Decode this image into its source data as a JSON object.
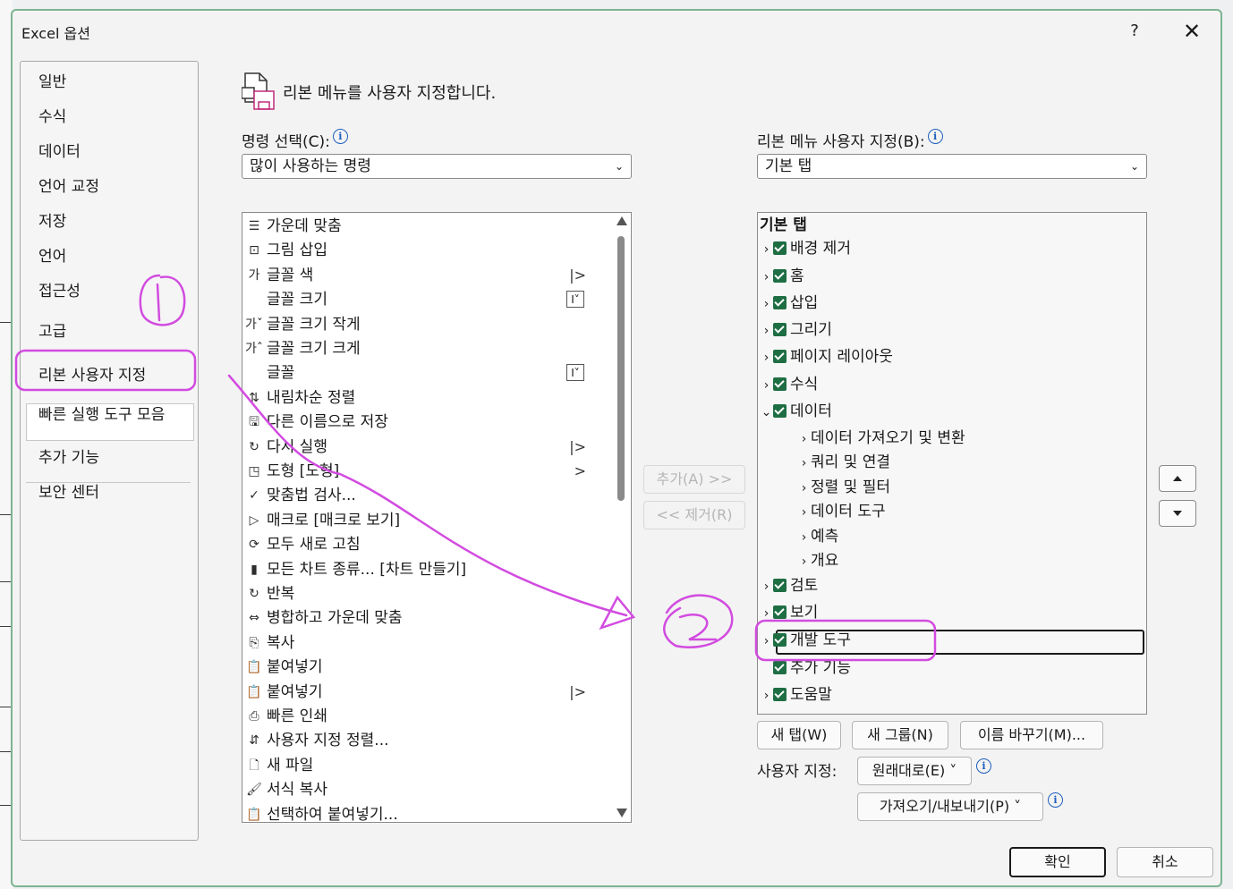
{
  "dialog": {
    "title": "Excel 옵션",
    "help": "?",
    "close": "✕"
  },
  "nav": {
    "items": [
      "일반",
      "수식",
      "데이터",
      "언어 교정",
      "저장",
      "언어",
      "접근성",
      "고급",
      "리본 사용자 지정",
      "빠른 실행 도구 모음",
      "추가 기능",
      "보안 센터"
    ],
    "selected": "리본 사용자 지정"
  },
  "header": {
    "text": "리본 메뉴를 사용자 지정합니다."
  },
  "commands": {
    "label": "명령 선택(C):",
    "combo_value": "많이 사용하는 명령",
    "items": [
      {
        "icon": "center-align-icon",
        "glyph": "☰",
        "label": "가운데 맞춤",
        "sub": ""
      },
      {
        "icon": "insert-picture-icon",
        "glyph": "⊡",
        "label": "그림 삽입",
        "sub": ""
      },
      {
        "icon": "font-color-icon",
        "glyph": "가",
        "label": "글꼴 색",
        "sub": "|>"
      },
      {
        "icon": "",
        "glyph": "",
        "label": "글꼴 크기",
        "sub": "box"
      },
      {
        "icon": "decrease-font-icon",
        "glyph": "가ˇ",
        "label": "글꼴 크기 작게",
        "sub": ""
      },
      {
        "icon": "increase-font-icon",
        "glyph": "가ˆ",
        "label": "글꼴 크기 크게",
        "sub": ""
      },
      {
        "icon": "",
        "glyph": "",
        "label": "글꼴",
        "sub": "box"
      },
      {
        "icon": "sort-descending-icon",
        "glyph": "⇅",
        "label": "내림차순 정렬",
        "sub": ""
      },
      {
        "icon": "save-as-icon",
        "glyph": "🖫",
        "label": "다른 이름으로 저장",
        "sub": ""
      },
      {
        "icon": "redo-icon",
        "glyph": "↻",
        "label": "다시 실행",
        "sub": "|>"
      },
      {
        "icon": "shapes-icon",
        "glyph": "◳",
        "label": "도형 [도형]",
        "sub": ">"
      },
      {
        "icon": "spelling-icon",
        "glyph": "✓",
        "label": "맞춤법 검사...",
        "sub": ""
      },
      {
        "icon": "macro-icon",
        "glyph": "▷",
        "label": "매크로 [매크로 보기]",
        "sub": ""
      },
      {
        "icon": "refresh-all-icon",
        "glyph": "⟳",
        "label": "모두 새로 고침",
        "sub": ""
      },
      {
        "icon": "chart-icon",
        "glyph": "▮",
        "label": "모든 차트 종류... [차트 만들기]",
        "sub": ""
      },
      {
        "icon": "repeat-icon",
        "glyph": "↻",
        "label": "반복",
        "sub": ""
      },
      {
        "icon": "merge-center-icon",
        "glyph": "⇔",
        "label": "병합하고 가운데 맞춤",
        "sub": ""
      },
      {
        "icon": "copy-icon",
        "glyph": "⎘",
        "label": "복사",
        "sub": ""
      },
      {
        "icon": "paste-icon",
        "glyph": "📋",
        "label": "붙여넣기",
        "sub": ""
      },
      {
        "icon": "paste-icon",
        "glyph": "📋",
        "label": "붙여넣기",
        "sub": "|>"
      },
      {
        "icon": "quick-print-icon",
        "glyph": "⎙",
        "label": "빠른 인쇄",
        "sub": ""
      },
      {
        "icon": "custom-sort-icon",
        "glyph": "⇵",
        "label": "사용자 지정 정렬...",
        "sub": ""
      },
      {
        "icon": "new-file-icon",
        "glyph": "🗋",
        "label": "새 파일",
        "sub": ""
      },
      {
        "icon": "format-painter-icon",
        "glyph": "🖌",
        "label": "서식 복사",
        "sub": ""
      },
      {
        "icon": "paste-special-icon",
        "glyph": "📋",
        "label": "선택하여 붙여넣기...",
        "sub": ""
      }
    ]
  },
  "middle": {
    "add": "추가(A) >>",
    "remove": "<< 제거(R)"
  },
  "ribbon": {
    "label": "리본 메뉴 사용자 지정(B):",
    "combo_value": "기본 탭",
    "root": "기본 탭",
    "items": [
      {
        "label": "배경 제거",
        "level": 1,
        "check": true,
        "twisty": ">"
      },
      {
        "label": "홈",
        "level": 1,
        "check": true,
        "twisty": ">"
      },
      {
        "label": "삽입",
        "level": 1,
        "check": true,
        "twisty": ">"
      },
      {
        "label": "그리기",
        "level": 1,
        "check": true,
        "twisty": ">"
      },
      {
        "label": "페이지 레이아웃",
        "level": 1,
        "check": true,
        "twisty": ">"
      },
      {
        "label": "수식",
        "level": 1,
        "check": true,
        "twisty": ">"
      },
      {
        "label": "데이터",
        "level": 1,
        "check": true,
        "twisty": "v"
      },
      {
        "label": "데이터 가져오기 및 변환",
        "level": 2,
        "check": false,
        "twisty": ">"
      },
      {
        "label": "쿼리 및 연결",
        "level": 2,
        "check": false,
        "twisty": ">"
      },
      {
        "label": "정렬 및 필터",
        "level": 2,
        "check": false,
        "twisty": ">"
      },
      {
        "label": "데이터 도구",
        "level": 2,
        "check": false,
        "twisty": ">"
      },
      {
        "label": "예측",
        "level": 2,
        "check": false,
        "twisty": ">"
      },
      {
        "label": "개요",
        "level": 2,
        "check": false,
        "twisty": ">"
      },
      {
        "label": "검토",
        "level": 1,
        "check": true,
        "twisty": ">"
      },
      {
        "label": "보기",
        "level": 1,
        "check": true,
        "twisty": ">"
      },
      {
        "label": "개발 도구",
        "level": 1,
        "check": true,
        "twisty": ">"
      },
      {
        "label": "추가 기능",
        "level": 1,
        "check": true,
        "twisty": ""
      },
      {
        "label": "도움말",
        "level": 1,
        "check": true,
        "twisty": ">"
      }
    ],
    "selected": "개발 도구",
    "new_tab": "새 탭(W)",
    "new_group": "새 그룹(N)",
    "rename": "이름 바꾸기(M)...",
    "customize_label": "사용자 지정:",
    "reset": "원래대로(E) ˅",
    "import_export": "가져오기/내보내기(P) ˅"
  },
  "footer": {
    "ok": "확인",
    "cancel": "취소"
  },
  "annotations": {
    "mark1": "①",
    "mark2": "②",
    "color": "#d24be0"
  }
}
